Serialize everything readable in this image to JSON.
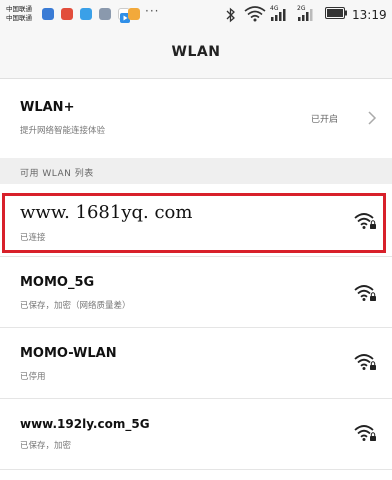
{
  "status_bar": {
    "carrier_1": "中国联通",
    "carrier_2": "中国联通",
    "notification_more": "···",
    "network_4g": "4G",
    "network_2g": "2G",
    "time": "13:19"
  },
  "header": {
    "title": "WLAN"
  },
  "wlan_plus": {
    "title": "WLAN+",
    "subtitle": "提升网络智能连接体验",
    "status": "已开启"
  },
  "section": {
    "label": "可用 WLAN 列表"
  },
  "networks": [
    {
      "name": "www. 1681yq. com",
      "status": "已连接",
      "icon": "wifi-lock-icon"
    },
    {
      "name": "MOMO_5G",
      "status": "已保存，加密（网络质量差）",
      "icon": "wifi-lock-icon"
    },
    {
      "name": "MOMO-WLAN",
      "status": "已停用",
      "icon": "wifi-lock-icon"
    },
    {
      "name": "www.192ly.com_5G",
      "status": "已保存，加密",
      "icon": "wifi-lock-icon"
    }
  ],
  "colors": {
    "highlight_frame": "#d8202a",
    "background": "#ffffff",
    "section_background": "#efefef"
  }
}
